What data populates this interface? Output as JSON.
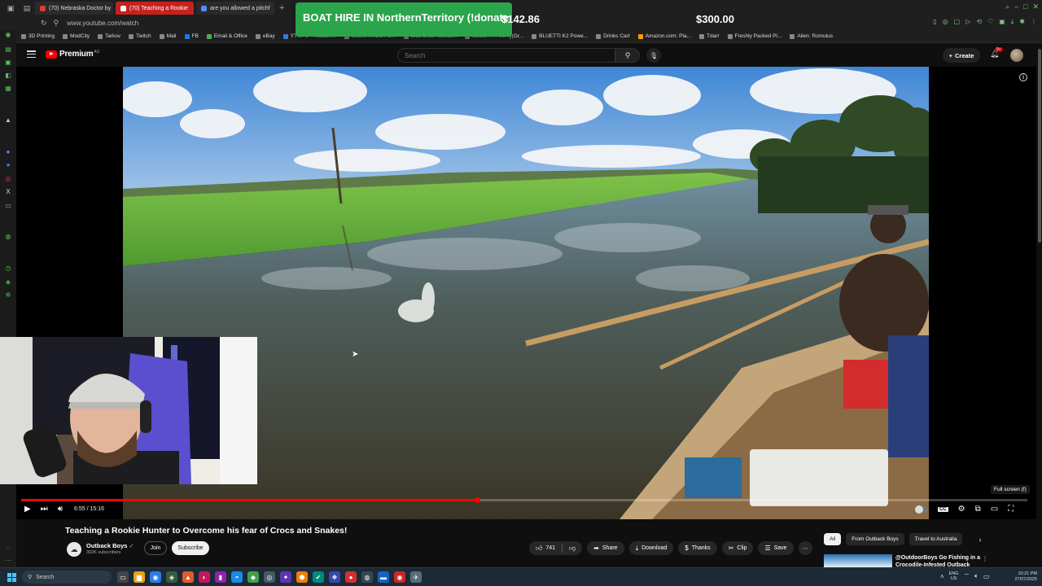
{
  "browser": {
    "tabs": [
      {
        "label": "(70) Nebraska Doctor by",
        "active": false
      },
      {
        "label": "(70) Teaching a Rookie",
        "active": true
      },
      {
        "label": "are you allowed a pitchf",
        "active": false
      }
    ],
    "url": "www.youtube.com/watch",
    "bookmarks": [
      "3D Printing",
      "ModCity",
      "Tarkov",
      "Twitch",
      "Mail",
      "FB",
      "Email & Office",
      "eBay",
      "YTMP3 - Youtube...",
      "Boons Amber Ac...",
      "Blue Dets Australi...",
      "BLUETTI FireFly(Gr...",
      "BLUETTI K2 Powe...",
      "Drinks Cart",
      "Amazon.com: Pla...",
      "Tdarr",
      "Freshly Packed Pl...",
      "Alien: Romulus"
    ]
  },
  "overlay": {
    "banner_text": "BOAT HIRE IN NorthernTerritory (!donate",
    "amount_1": "$142.86",
    "amount_2": "$300.00"
  },
  "youtube": {
    "logo_text": "Premium",
    "logo_region": "AU",
    "search_placeholder": "Search",
    "create_label": "Create",
    "notification_count": "9+"
  },
  "player": {
    "current_time": "6:55",
    "duration": "15:16",
    "time_display": "6:55 / 15:16",
    "progress": 0.4533,
    "fullscreen_tooltip": "Full screen (f)"
  },
  "video": {
    "title": "Teaching a Rookie Hunter to Overcome his fear of Crocs and Snakes!",
    "channel_name": "Outback Boys",
    "subscribers": "302K subscribers",
    "join_label": "Join",
    "subscribe_label": "Subscribe",
    "like_count": "741",
    "share_label": "Share",
    "download_label": "Download",
    "thanks_label": "Thanks",
    "clip_label": "Clip",
    "save_label": "Save"
  },
  "recommendations": {
    "chips": [
      "All",
      "From Outback Boys",
      "Travel to Australia"
    ],
    "first_title": "@OutdoorBoys Go Fishing in a Crocodile-Infested Outback"
  },
  "taskbar": {
    "search_placeholder": "Search",
    "lang_top": "ENG",
    "lang_bottom": "US",
    "time": "10:21 PM",
    "date": "27/07/2025"
  },
  "colors": {
    "yt_red": "#ff0000",
    "banner_green": "#2aa54b",
    "background": "#0f0f0f"
  }
}
